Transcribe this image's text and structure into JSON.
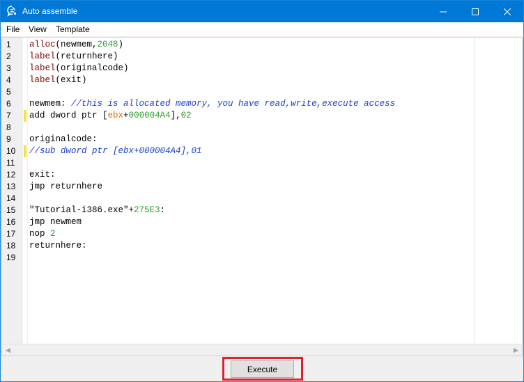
{
  "window": {
    "title": "Auto assemble",
    "titlebar_color": "#0078d7"
  },
  "menu": {
    "items": [
      "File",
      "View",
      "Template"
    ]
  },
  "editor": {
    "lines": [
      {
        "n": "1",
        "changed": false,
        "tokens": [
          {
            "t": "alloc",
            "c": "kw"
          },
          {
            "t": "(newmem,"
          },
          {
            "t": "2048",
            "c": "num"
          },
          {
            "t": ")"
          }
        ]
      },
      {
        "n": "2",
        "changed": false,
        "tokens": [
          {
            "t": "label",
            "c": "kw"
          },
          {
            "t": "(returnhere)"
          }
        ]
      },
      {
        "n": "3",
        "changed": false,
        "tokens": [
          {
            "t": "label",
            "c": "kw"
          },
          {
            "t": "(originalcode)"
          }
        ]
      },
      {
        "n": "4",
        "changed": false,
        "tokens": [
          {
            "t": "label",
            "c": "kw"
          },
          {
            "t": "(exit)"
          }
        ]
      },
      {
        "n": "5",
        "changed": false,
        "tokens": []
      },
      {
        "n": "6",
        "changed": false,
        "tokens": [
          {
            "t": "newmem: "
          },
          {
            "t": "//this is allocated memory, you have read,write,execute access",
            "c": "cmt"
          }
        ]
      },
      {
        "n": "7",
        "changed": true,
        "tokens": [
          {
            "t": "add dword ptr ["
          },
          {
            "t": "ebx",
            "c": "reg"
          },
          {
            "t": "+"
          },
          {
            "t": "000004A4",
            "c": "num"
          },
          {
            "t": "],"
          },
          {
            "t": "02",
            "c": "num"
          }
        ]
      },
      {
        "n": "8",
        "changed": false,
        "tokens": []
      },
      {
        "n": "9",
        "changed": false,
        "tokens": [
          {
            "t": "originalcode:"
          }
        ]
      },
      {
        "n": "10",
        "changed": true,
        "tokens": [
          {
            "t": "//sub dword ptr [ebx+000004A4],01",
            "c": "cmt"
          }
        ]
      },
      {
        "n": "11",
        "changed": false,
        "tokens": []
      },
      {
        "n": "12",
        "changed": false,
        "tokens": [
          {
            "t": "exit:"
          }
        ]
      },
      {
        "n": "13",
        "changed": false,
        "tokens": [
          {
            "t": "jmp returnhere"
          }
        ]
      },
      {
        "n": "14",
        "changed": false,
        "tokens": []
      },
      {
        "n": "15",
        "changed": false,
        "tokens": [
          {
            "t": "\"Tutorial-i386.exe\"+"
          },
          {
            "t": "275E3",
            "c": "num"
          },
          {
            "t": ":"
          }
        ]
      },
      {
        "n": "16",
        "changed": false,
        "tokens": [
          {
            "t": "jmp newmem"
          }
        ]
      },
      {
        "n": "17",
        "changed": false,
        "tokens": [
          {
            "t": "nop "
          },
          {
            "t": "2",
            "c": "num"
          }
        ]
      },
      {
        "n": "18",
        "changed": false,
        "tokens": [
          {
            "t": "returnhere:"
          }
        ]
      },
      {
        "n": "19",
        "changed": false,
        "tokens": []
      }
    ]
  },
  "actions": {
    "execute_label": "Execute"
  },
  "colors": {
    "keyword": "#800000",
    "number": "#2f9e2f",
    "register": "#e07000",
    "comment": "#1a3fcf",
    "change_marker": "#f5e342",
    "highlight": "#e0202a"
  }
}
